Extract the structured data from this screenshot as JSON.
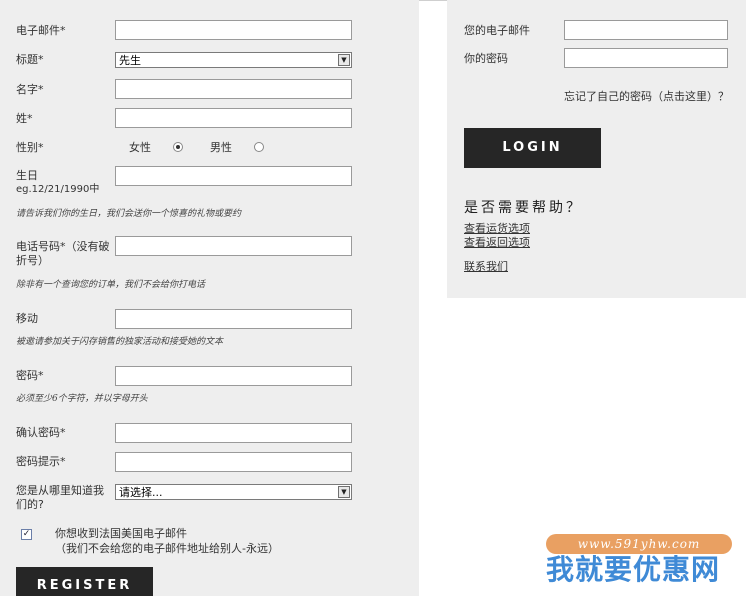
{
  "register": {
    "email_label": "电子邮件*",
    "title_label": "标题*",
    "title_value": "先生",
    "firstname_label": "名字*",
    "lastname_label": "姓*",
    "gender_label": "性别*",
    "gender_female": "女性",
    "gender_male": "男性",
    "gender_selected": "female",
    "birthday_label": "生日",
    "birthday_example": "eg.12/21/1990中",
    "birthday_hint": "请告诉我们你的生日，我们会送你一个惊喜的礼物或要约",
    "phone_label_line1": "电话号码*（没有破",
    "phone_label_line2": "折号）",
    "phone_hint": "除非有一个查询您的订单，我们不会给你打电话",
    "mobile_label": "移动",
    "mobile_hint": "被邀请参加关于闪存销售的独家活动和接受她的文本",
    "password_label": "密码*",
    "password_hint": "必须至少6个字符，并以字母开头",
    "confirm_label": "确认密码*",
    "reminder_label": "密码提示*",
    "source_label_line1": "您是从哪里知道我",
    "source_label_line2": "们的?",
    "source_value": "请选择...",
    "newsletter_checked": true,
    "newsletter_line1": "你想收到法国美国电子邮件",
    "newsletter_line2": "（我们不会给您的电子邮件地址给别人-永远）",
    "register_button": "REGISTER"
  },
  "login": {
    "email_label": "您的电子邮件",
    "password_label": "你的密码",
    "forgot_link": "忘记了自己的密码（点击这里）？",
    "login_button": "LOGIN"
  },
  "help": {
    "title": "是否需要帮助？",
    "shipping_link": "查看运货选项",
    "returns_link": "查看返回选项",
    "contact_link": "联系我们"
  },
  "watermark": {
    "url": "www.591yhw.com",
    "name": "我就要优惠网"
  }
}
